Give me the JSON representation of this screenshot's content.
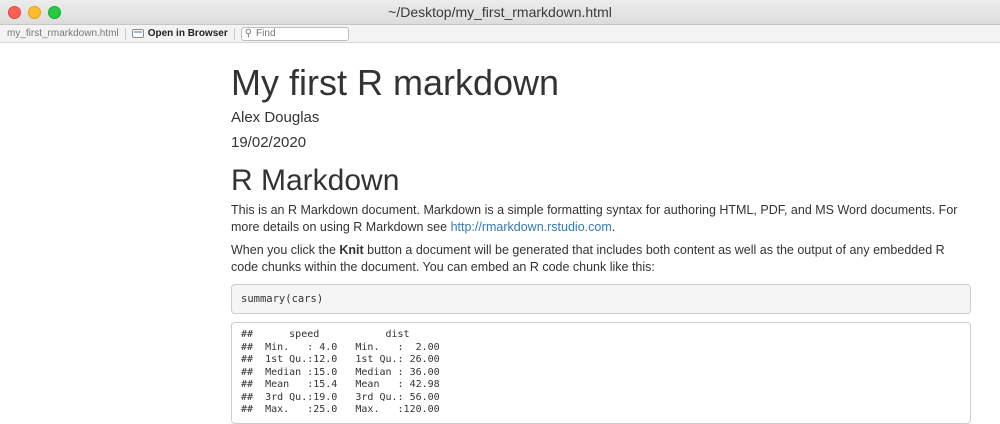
{
  "window": {
    "title": "~/Desktop/my_first_rmarkdown.html"
  },
  "toolbar": {
    "filename": "my_first_rmarkdown.html",
    "open_in_browser": "Open in Browser",
    "find_placeholder": "Find"
  },
  "document": {
    "title": "My first R markdown",
    "author": "Alex Douglas",
    "date": "19/02/2020",
    "section_heading": "R Markdown",
    "para1_text": "This is an R Markdown document. Markdown is a simple formatting syntax for authoring HTML, PDF, and MS Word documents. For more details on using R Markdown see ",
    "para1_link": "http://rmarkdown.rstudio.com",
    "para1_end": ".",
    "para2_before": "When you click the ",
    "para2_bold": "Knit",
    "para2_after": " button a document will be generated that includes both content as well as the output of any embedded R code chunks within the document. You can embed an R code chunk like this:",
    "code": "summary(cars)",
    "output_lines": [
      "##      speed           dist       ",
      "##  Min.   : 4.0   Min.   :  2.00  ",
      "##  1st Qu.:12.0   1st Qu.: 26.00  ",
      "##  Median :15.0   Median : 36.00  ",
      "##  Mean   :15.4   Mean   : 42.98  ",
      "##  3rd Qu.:19.0   3rd Qu.: 56.00  ",
      "##  Max.   :25.0   Max.   :120.00  "
    ]
  }
}
